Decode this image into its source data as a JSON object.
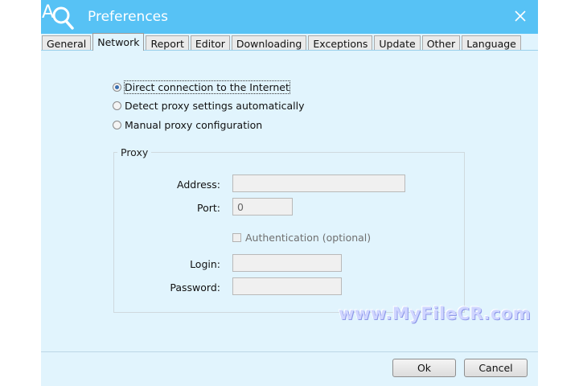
{
  "window": {
    "title": "Preferences"
  },
  "tabs": [
    {
      "label": "General"
    },
    {
      "label": "Network",
      "active": true
    },
    {
      "label": "Report"
    },
    {
      "label": "Editor"
    },
    {
      "label": "Downloading"
    },
    {
      "label": "Exceptions"
    },
    {
      "label": "Update"
    },
    {
      "label": "Other"
    },
    {
      "label": "Language"
    }
  ],
  "connection": {
    "options": [
      {
        "label": "Direct connection to the Internet",
        "selected": true
      },
      {
        "label": "Detect proxy settings automatically",
        "selected": false
      },
      {
        "label": "Manual proxy configuration",
        "selected": false
      }
    ]
  },
  "proxy": {
    "group_title": "Proxy",
    "address_label": "Address:",
    "address_value": "",
    "port_label": "Port:",
    "port_value": "0",
    "auth_label": "Authentication (optional)",
    "auth_checked": false,
    "login_label": "Login:",
    "login_value": "",
    "password_label": "Password:",
    "password_value": ""
  },
  "buttons": {
    "ok": "Ok",
    "cancel": "Cancel"
  },
  "watermark": "www.MyFileCR.com",
  "colors": {
    "titlebar": "#57c2f5",
    "background": "#e1f4fd"
  },
  "icons": {
    "logo": "app-logo-magnifier-icon",
    "close": "close-icon"
  }
}
